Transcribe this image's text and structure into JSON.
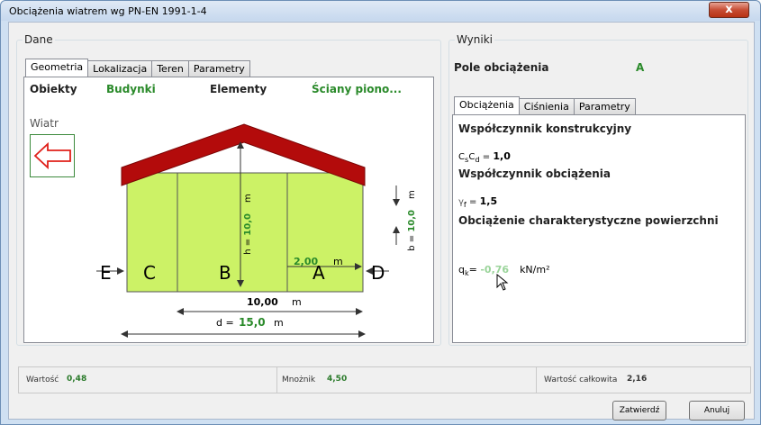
{
  "window": {
    "title": "Obciążenia wiatrem wg PN-EN 1991-1-4",
    "close_glyph": "x"
  },
  "dane": {
    "group_title": "Dane",
    "tabs": [
      "Geometria",
      "Lokalizacja",
      "Teren",
      "Parametry"
    ],
    "obiekty_label": "Obiekty",
    "obiekty_value": "Budynki",
    "elementy_label": "Elementy",
    "elementy_value": "Ściany piono...",
    "wind_label": "Wiatr",
    "zones": {
      "E": "E",
      "C": "C",
      "B": "B",
      "A": "A",
      "D": "D"
    },
    "dims": {
      "h_prefix": "h = ",
      "h_value": "10,0",
      "h_unit": "m",
      "b_prefix": "b = ",
      "b_value": "10,0",
      "b_unit": "m",
      "a_value": "2,00",
      "a_unit": "m",
      "e_value": "10,00",
      "e_unit": "m",
      "d_prefix": "d = ",
      "d_value": "15,0",
      "d_unit": "m"
    },
    "colors": {
      "roof": "#b30b0b",
      "wall": "#ccf266",
      "arrow": "#e0201a",
      "green": "#2a8a2a"
    }
  },
  "wyniki": {
    "group_title": "Wyniki",
    "pole_label": "Pole obciążenia",
    "pole_value": "A",
    "tabs": [
      "Obciążenia",
      "Ciśnienia",
      "Parametry"
    ],
    "wsp_konstr_title": "Współczynnik konstrukcyjny",
    "cscd_label": "C",
    "cscd_sub_s": "s",
    "cscd_mid": "C",
    "cscd_sub_d": "d",
    "cscd_eq": " = ",
    "cscd_value": "1,0",
    "wsp_obc_title": "Współczynnik obciążenia",
    "gamma_label": "γ",
    "gamma_sub": "f",
    "gamma_eq": " = ",
    "gamma_value": "1,5",
    "char_title": "Obciążenie charakterystyczne powierzchni",
    "qk_label": "q",
    "qk_sub": "k",
    "qk_eq": "= ",
    "qk_value": "-0,76",
    "qk_unit": "kN/m²"
  },
  "status": {
    "wartosc_label": "Wartość",
    "wartosc_value": "0,48",
    "mnoznik_label": "Mnożnik",
    "mnoznik_value": "4,50",
    "calkowita_label": "Wartość całkowita",
    "calkowita_value": "2,16"
  },
  "buttons": {
    "ok": "Zatwierdź",
    "cancel": "Anuluj"
  }
}
